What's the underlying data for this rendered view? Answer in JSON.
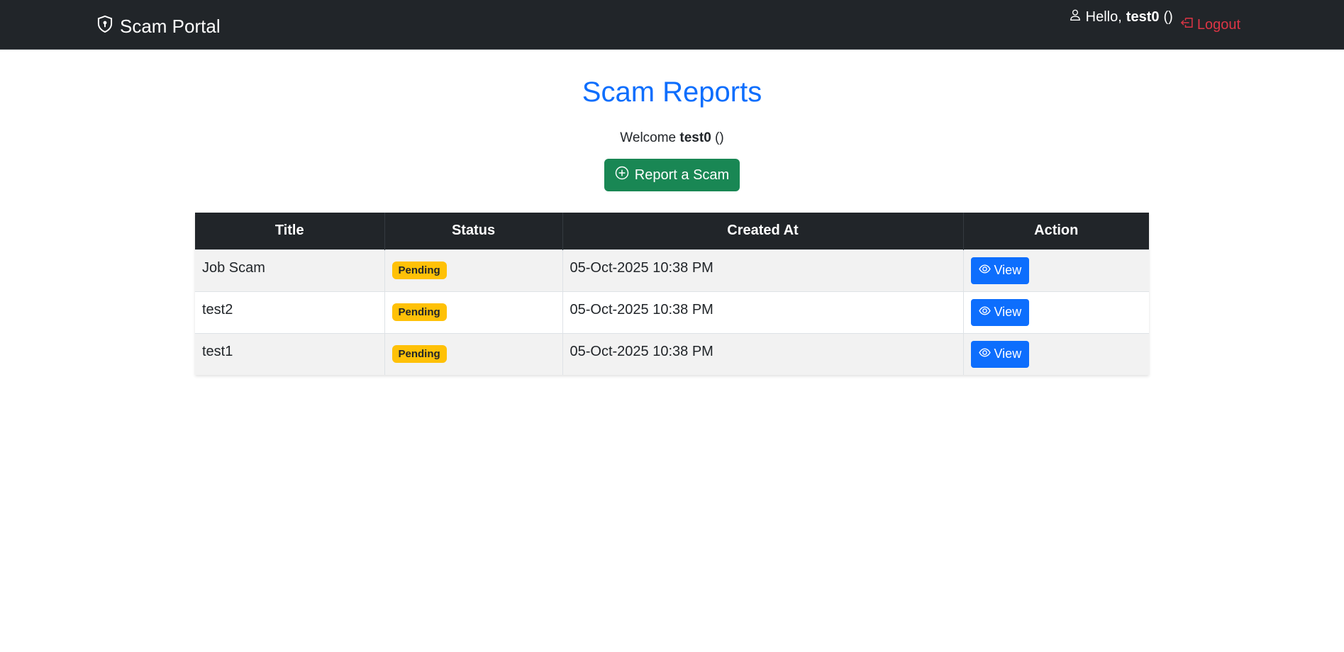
{
  "navbar": {
    "brand": "Scam Portal",
    "hello_prefix": "Hello,",
    "username": "test0",
    "username_suffix": "()",
    "logout_label": "Logout"
  },
  "main": {
    "title": "Scam Reports",
    "welcome_prefix": "Welcome",
    "welcome_user": "test0",
    "welcome_suffix": "()",
    "report_button_label": "Report a Scam"
  },
  "table": {
    "headers": [
      "Title",
      "Status",
      "Created At",
      "Action"
    ],
    "rows": [
      {
        "title": "Job Scam",
        "status": "Pending",
        "created_at": "05-Oct-2025 10:38 PM",
        "action": "View"
      },
      {
        "title": "test2",
        "status": "Pending",
        "created_at": "05-Oct-2025 10:38 PM",
        "action": "View"
      },
      {
        "title": "test1",
        "status": "Pending",
        "created_at": "05-Oct-2025 10:38 PM",
        "action": "View"
      }
    ]
  },
  "colors": {
    "navbar_bg": "#212529",
    "primary": "#0d6efd",
    "success": "#198754",
    "warning": "#ffc107",
    "danger": "#dc3545"
  },
  "icons": {
    "brand": "shield-lock-icon",
    "user": "person-icon",
    "logout": "box-arrow-left-icon",
    "report": "plus-circle-icon",
    "view": "eye-icon"
  }
}
